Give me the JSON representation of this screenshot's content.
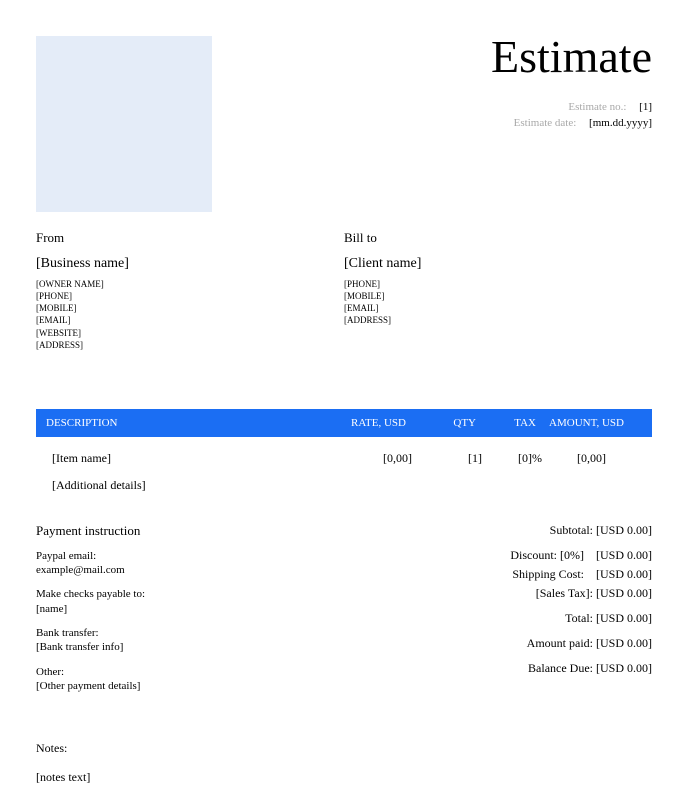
{
  "title": "Estimate",
  "meta": {
    "no_label": "Estimate no.:",
    "no_value": "[1]",
    "date_label": "Estimate date:",
    "date_value": "[mm.dd.yyyy]"
  },
  "from": {
    "heading": "From",
    "name": "[Business name]",
    "lines": [
      "[OWNER NAME]",
      "[PHONE]",
      "[MOBILE]",
      "[EMAIL]",
      "[WEBSITE]",
      "[ADDRESS]"
    ]
  },
  "billto": {
    "heading": "Bill to",
    "name": "[Client name]",
    "lines": [
      "[PHONE]",
      "[MOBILE]",
      "[EMAIL]",
      "[ADDRESS]"
    ]
  },
  "table": {
    "headers": {
      "desc": "DESCRIPTION",
      "rate": "RATE, USD",
      "qty": "QTY",
      "tax": "TAX",
      "amount": "AMOUNT, USD"
    },
    "rows": [
      {
        "desc": "[Item name]",
        "rate": "[0,00]",
        "qty": "[1]",
        "tax": "[0]%",
        "amount": "[0,00]",
        "details": "[Additional details]"
      }
    ]
  },
  "payment": {
    "heading": "Payment instruction",
    "paypal_label": "Paypal email:",
    "paypal_value": "example@mail.com",
    "checks_label": "Make checks payable to:",
    "checks_value": "[name]",
    "bank_label": "Bank transfer:",
    "bank_value": "[Bank transfer info]",
    "other_label": "Other:",
    "other_value": "[Other payment details]"
  },
  "totals": {
    "subtotal_label": "Subtotal:",
    "subtotal_value": "[USD 0.00]",
    "discount_label": "Discount: [0%]",
    "discount_value": "[USD 0.00]",
    "shipping_label": "Shipping Cost:",
    "shipping_value": "[USD 0.00]",
    "salestax_label": "[Sales Tax]:",
    "salestax_value": "[USD 0.00]",
    "total_label": "Total:",
    "total_value": "[USD 0.00]",
    "paid_label": "Amount paid:",
    "paid_value": "[USD 0.00]",
    "balance_label": "Balance Due:",
    "balance_value": "[USD 0.00]"
  },
  "notes": {
    "heading": "Notes:",
    "text": "[notes text]"
  }
}
